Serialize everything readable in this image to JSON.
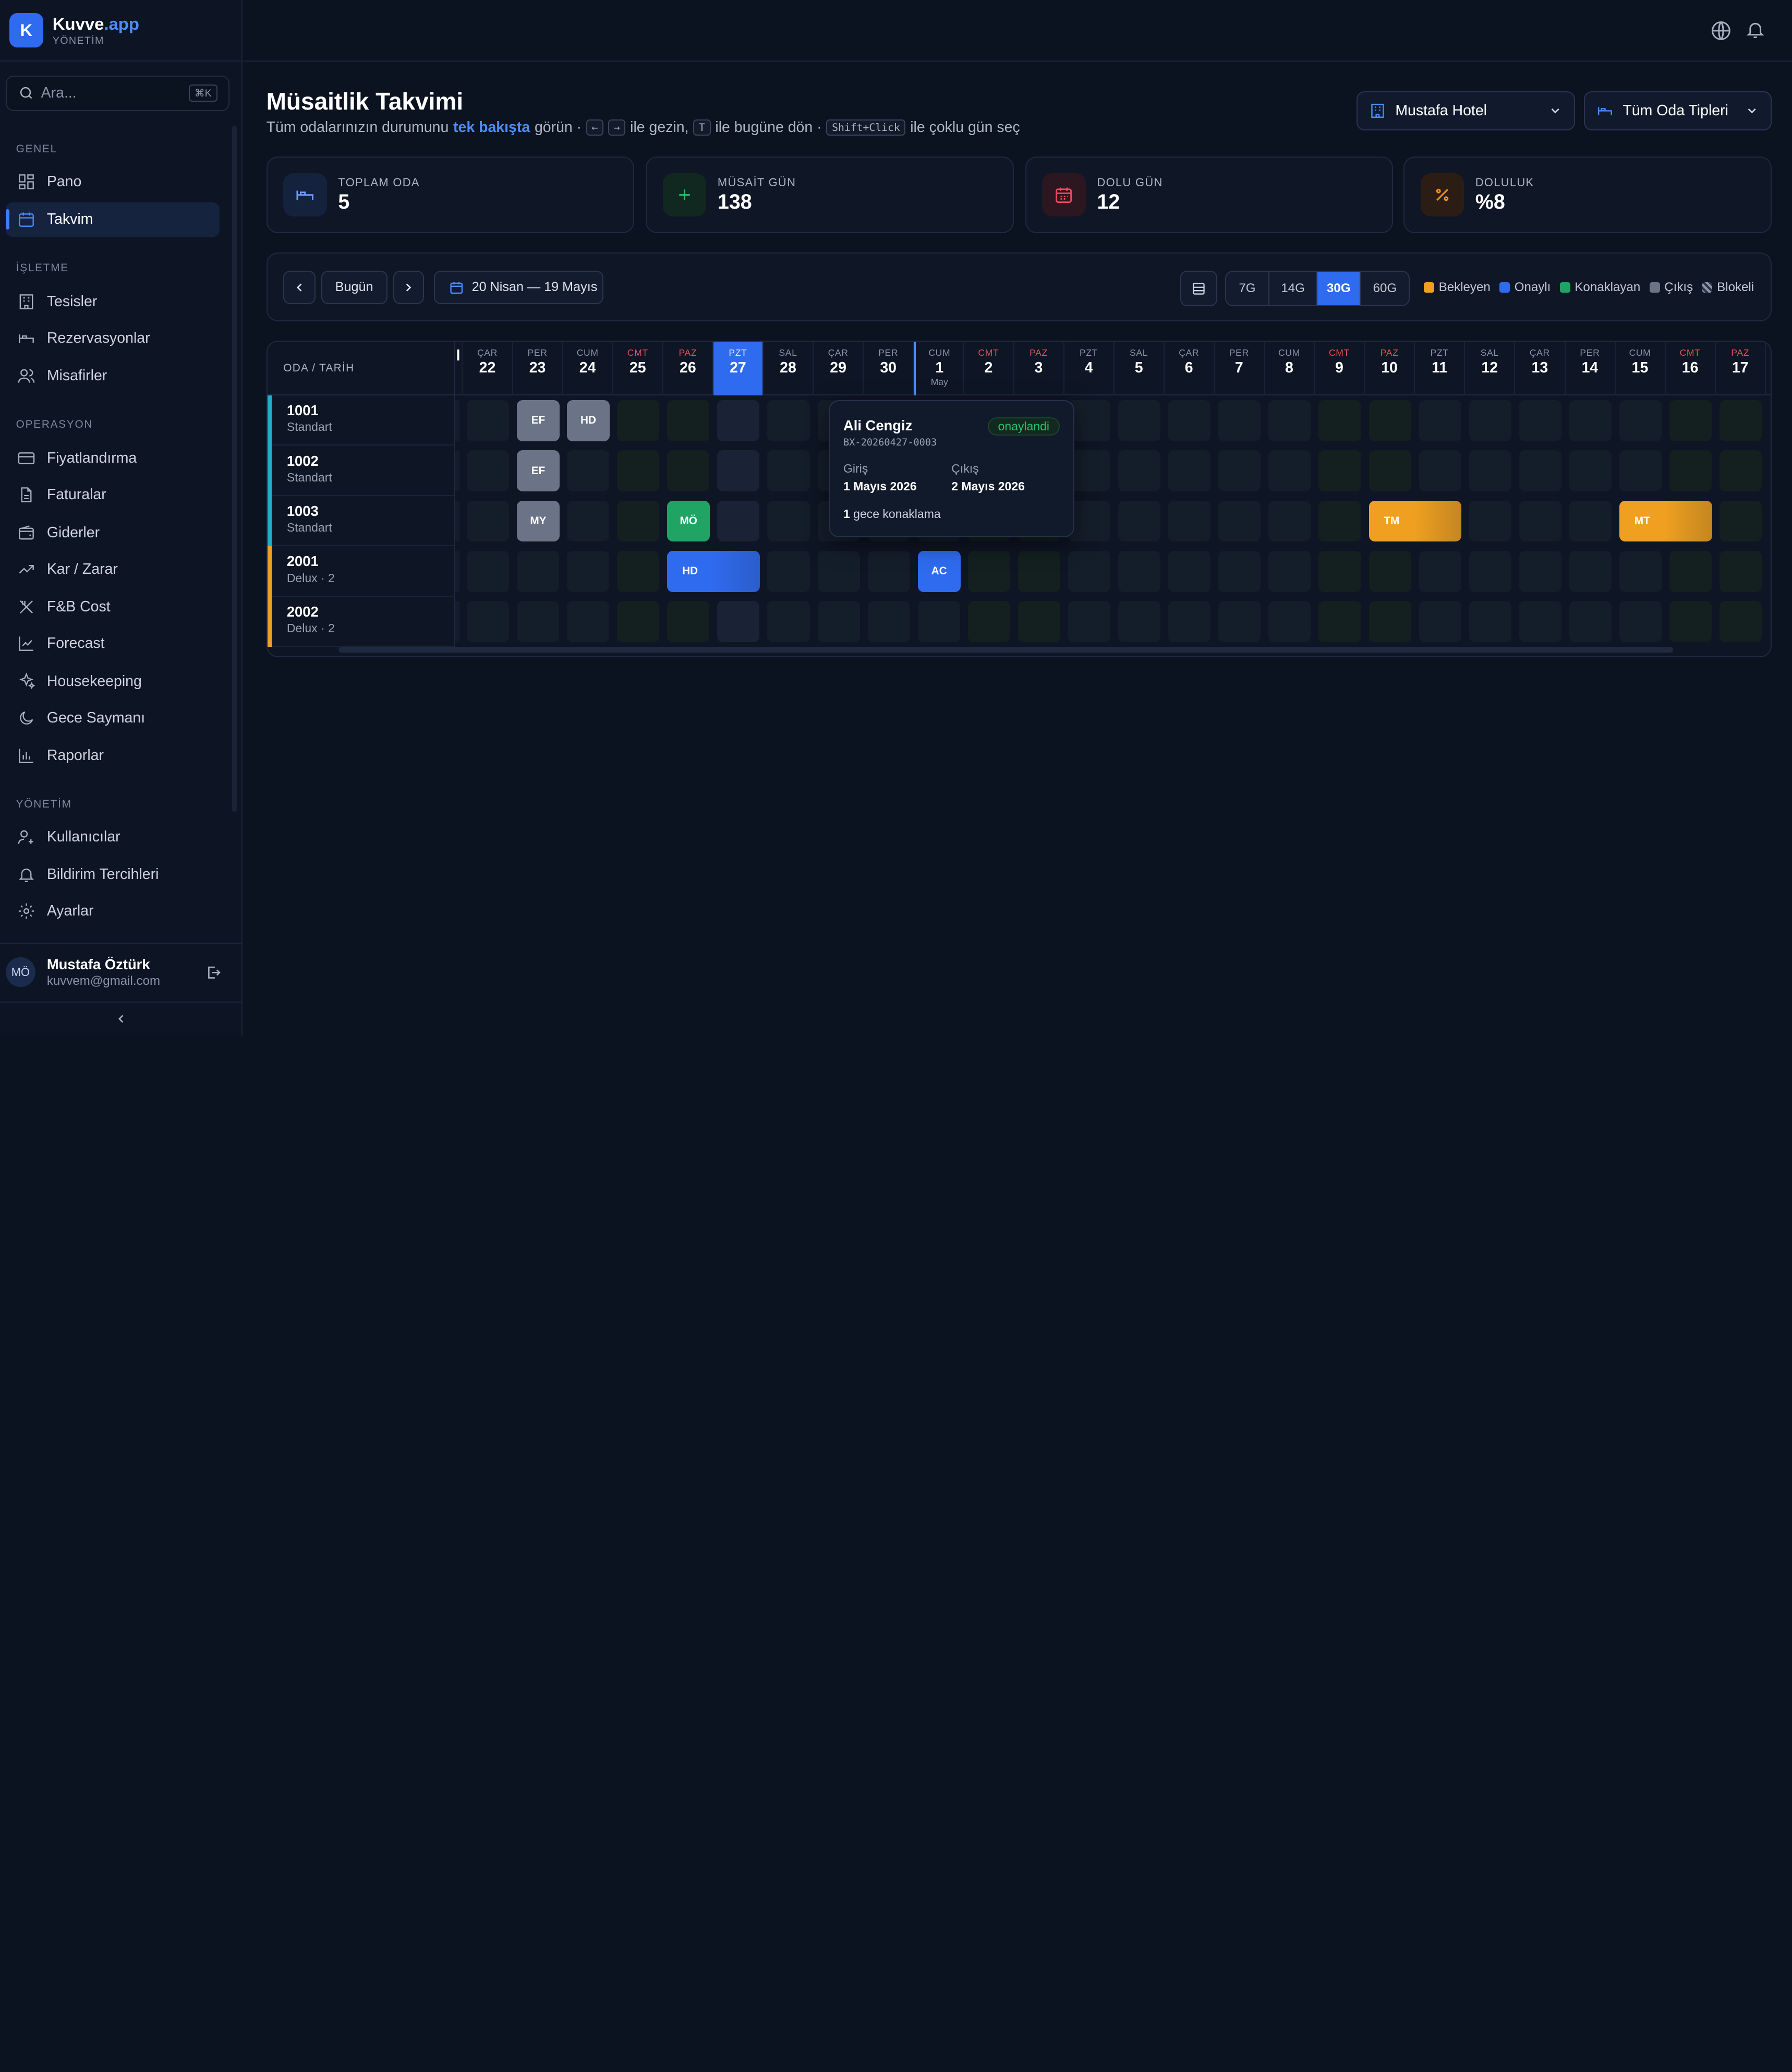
{
  "brand": {
    "name": "Kuvve",
    "tld": ".app",
    "sub": "YÖNETİM",
    "logo_letter": "K"
  },
  "search": {
    "placeholder": "Ara...",
    "shortcut": "⌘K"
  },
  "nav": {
    "groups": {
      "g1": "GENEL",
      "g2": "İŞLETME",
      "g3": "OPERASYON",
      "g4": "YÖNETİM"
    },
    "items": {
      "pano": "Pano",
      "takvim": "Takvim",
      "tesisler": "Tesisler",
      "rezervasyonlar": "Rezervasyonlar",
      "misafirler": "Misafirler",
      "fiyatlandirma": "Fiyatlandırma",
      "faturalar": "Faturalar",
      "giderler": "Giderler",
      "karzarar": "Kar / Zarar",
      "fnb": "F&B Cost",
      "forecast": "Forecast",
      "housekeeping": "Housekeeping",
      "gece": "Gece Saymanı",
      "raporlar": "Raporlar",
      "kullanicilar": "Kullanıcılar",
      "bildirim": "Bildirim Tercihleri",
      "ayarlar": "Ayarlar"
    }
  },
  "user": {
    "initials": "MÖ",
    "name": "Mustafa Öztürk",
    "email": "kuvvem@gmail.com"
  },
  "page": {
    "title": "Müsaitlik Takvimi",
    "sub_a": "Tüm odalarınızın durumunu",
    "sub_hl": "tek bakışta",
    "sub_b": "görün ·",
    "key_left": "←",
    "key_right": "→",
    "sub_c": "ile gezin,",
    "key_t": "T",
    "sub_d": "ile bugüne dön ·",
    "key_shift": "Shift+Click",
    "sub_e": "ile çoklu gün seç"
  },
  "filters": {
    "hotel": "Mustafa Hotel",
    "room_type": "Tüm Oda Tipleri"
  },
  "stats": {
    "total": {
      "label": "TOPLAM ODA",
      "value": "5"
    },
    "free": {
      "label": "MÜSAİT GÜN",
      "value": "138"
    },
    "busy": {
      "label": "DOLU GÜN",
      "value": "12"
    },
    "occ": {
      "label": "DOLULUK",
      "value": "%8"
    }
  },
  "toolbar": {
    "today": "Bugün",
    "range": "20 Nisan — 19 Mayıs",
    "views": [
      "7G",
      "14G",
      "30G",
      "60G"
    ],
    "active_view": "30G",
    "legend": [
      {
        "label": "Bekleyen",
        "color": "#f0a020"
      },
      {
        "label": "Onaylı",
        "color": "#2f6bef"
      },
      {
        "label": "Konaklayan",
        "color": "#1fa463"
      },
      {
        "label": "Çıkış",
        "color": "#6b7386"
      },
      {
        "label": "Blokeli",
        "color": "#8b95a8"
      }
    ]
  },
  "calendar": {
    "corner": "ODA / TARİH",
    "days": [
      {
        "n": "",
        "d": "l"
      },
      {
        "n": "ÇAR",
        "d": "22"
      },
      {
        "n": "PER",
        "d": "23"
      },
      {
        "n": "CUM",
        "d": "24"
      },
      {
        "n": "CMT",
        "d": "25",
        "we": true
      },
      {
        "n": "PAZ",
        "d": "26",
        "we": true
      },
      {
        "n": "PZT",
        "d": "27",
        "today": true
      },
      {
        "n": "SAL",
        "d": "28"
      },
      {
        "n": "ÇAR",
        "d": "29"
      },
      {
        "n": "PER",
        "d": "30"
      },
      {
        "n": "CUM",
        "d": "1",
        "m": "May"
      },
      {
        "n": "CMT",
        "d": "2",
        "we": true
      },
      {
        "n": "PAZ",
        "d": "3",
        "we": true
      },
      {
        "n": "PZT",
        "d": "4"
      },
      {
        "n": "SAL",
        "d": "5"
      },
      {
        "n": "ÇAR",
        "d": "6"
      },
      {
        "n": "PER",
        "d": "7"
      },
      {
        "n": "CUM",
        "d": "8"
      },
      {
        "n": "CMT",
        "d": "9",
        "we": true
      },
      {
        "n": "PAZ",
        "d": "10",
        "we": true
      },
      {
        "n": "PZT",
        "d": "11"
      },
      {
        "n": "SAL",
        "d": "12"
      },
      {
        "n": "ÇAR",
        "d": "13"
      },
      {
        "n": "PER",
        "d": "14"
      },
      {
        "n": "CUM",
        "d": "15"
      },
      {
        "n": "CMT",
        "d": "16",
        "we": true
      },
      {
        "n": "PAZ",
        "d": "17",
        "we": true
      }
    ],
    "rooms": [
      {
        "no": "1001",
        "type": "Standart",
        "color": "#1ab1c9"
      },
      {
        "no": "1002",
        "type": "Standart",
        "color": "#1ab1c9"
      },
      {
        "no": "1003",
        "type": "Standart",
        "color": "#1ab1c9"
      },
      {
        "no": "2001",
        "type": "Delux · 2",
        "color": "#f0a020"
      },
      {
        "no": "2002",
        "type": "Delux · 2",
        "color": "#f0a020"
      }
    ],
    "bookings": [
      {
        "room": 0,
        "start": 2,
        "len": 1,
        "ini": "EF",
        "status": "cikis"
      },
      {
        "room": 0,
        "start": 3,
        "len": 1,
        "ini": "HD",
        "status": "cikis"
      },
      {
        "room": 1,
        "start": 2,
        "len": 1,
        "ini": "EF",
        "status": "cikis"
      },
      {
        "room": 2,
        "start": 2,
        "len": 1,
        "ini": "MY",
        "status": "cikis"
      },
      {
        "room": 2,
        "start": 5,
        "len": 1,
        "ini": "MÖ",
        "status": "konaklayan"
      },
      {
        "room": 2,
        "start": 19,
        "len": 2,
        "ini": "TM",
        "status": "bekleyen"
      },
      {
        "room": 2,
        "start": 24,
        "len": 2,
        "ini": "MT",
        "status": "bekleyen"
      },
      {
        "room": 3,
        "start": 5,
        "len": 2,
        "ini": "HD",
        "status": "onayli"
      },
      {
        "room": 3,
        "start": 10,
        "len": 1,
        "ini": "AC",
        "status": "onayli"
      }
    ]
  },
  "tooltip": {
    "name": "Ali Cengiz",
    "status": "onaylandi",
    "code": "BX-20260427-0003",
    "in_label": "Giriş",
    "in_value": "1 Mayıs 2026",
    "out_label": "Çıkış",
    "out_value": "2 Mayıs 2026",
    "nights_num": "1",
    "nights_text": "gece konaklama"
  }
}
